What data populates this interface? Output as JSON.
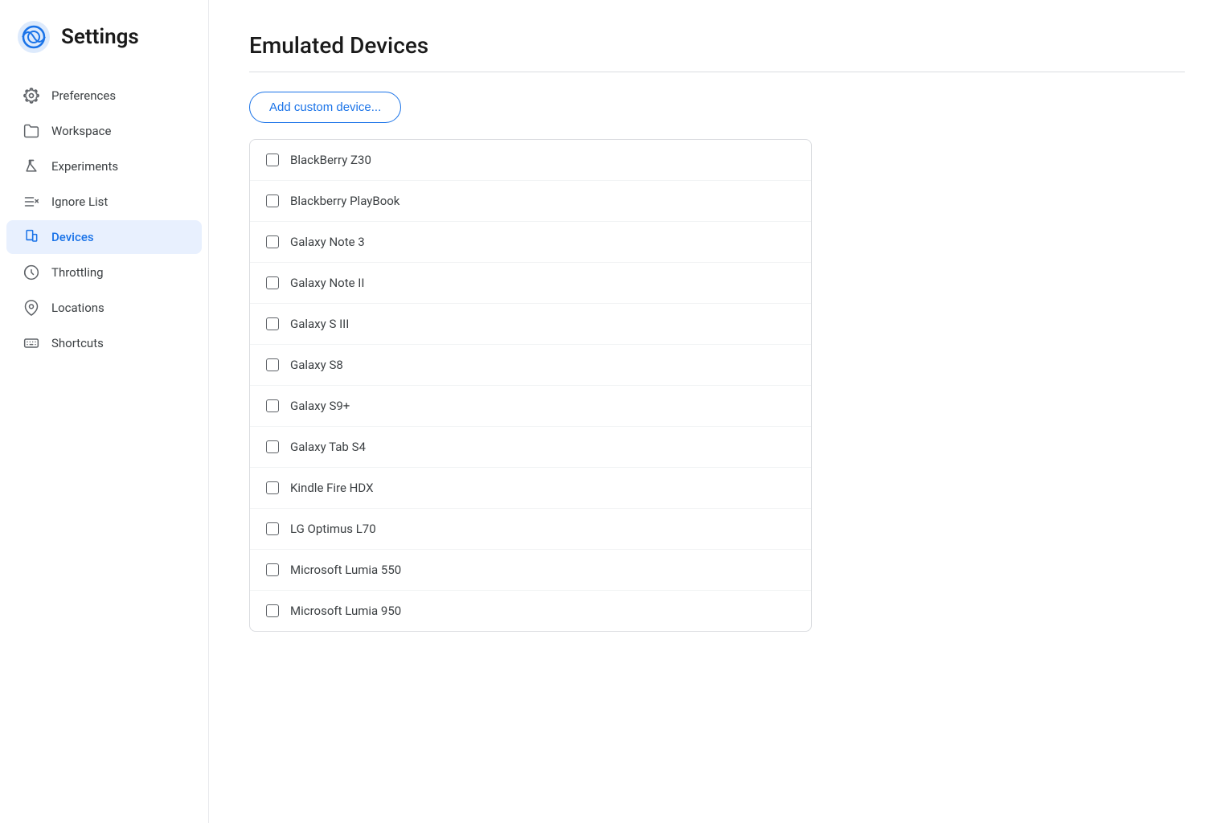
{
  "sidebar": {
    "title": "Settings",
    "items": [
      {
        "id": "preferences",
        "label": "Preferences",
        "icon": "gear",
        "active": false
      },
      {
        "id": "workspace",
        "label": "Workspace",
        "icon": "folder",
        "active": false
      },
      {
        "id": "experiments",
        "label": "Experiments",
        "icon": "flask",
        "active": false
      },
      {
        "id": "ignore-list",
        "label": "Ignore List",
        "icon": "list-x",
        "active": false
      },
      {
        "id": "devices",
        "label": "Devices",
        "icon": "device",
        "active": true
      },
      {
        "id": "throttling",
        "label": "Throttling",
        "icon": "throttle",
        "active": false
      },
      {
        "id": "locations",
        "label": "Locations",
        "icon": "location",
        "active": false
      },
      {
        "id": "shortcuts",
        "label": "Shortcuts",
        "icon": "keyboard",
        "active": false
      }
    ]
  },
  "main": {
    "title": "Emulated Devices",
    "add_button_label": "Add custom device...",
    "devices": [
      {
        "id": "blackberry-z30",
        "label": "BlackBerry Z30",
        "checked": false
      },
      {
        "id": "blackberry-playbook",
        "label": "Blackberry PlayBook",
        "checked": false
      },
      {
        "id": "galaxy-note-3",
        "label": "Galaxy Note 3",
        "checked": false
      },
      {
        "id": "galaxy-note-ii",
        "label": "Galaxy Note II",
        "checked": false
      },
      {
        "id": "galaxy-s-iii",
        "label": "Galaxy S III",
        "checked": false
      },
      {
        "id": "galaxy-s8",
        "label": "Galaxy S8",
        "checked": false
      },
      {
        "id": "galaxy-s9-plus",
        "label": "Galaxy S9+",
        "checked": false
      },
      {
        "id": "galaxy-tab-s4",
        "label": "Galaxy Tab S4",
        "checked": false
      },
      {
        "id": "kindle-fire-hdx",
        "label": "Kindle Fire HDX",
        "checked": false
      },
      {
        "id": "lg-optimus-l70",
        "label": "LG Optimus L70",
        "checked": false
      },
      {
        "id": "microsoft-lumia-550",
        "label": "Microsoft Lumia 550",
        "checked": false
      },
      {
        "id": "microsoft-lumia-950",
        "label": "Microsoft Lumia 950",
        "checked": false
      }
    ]
  }
}
